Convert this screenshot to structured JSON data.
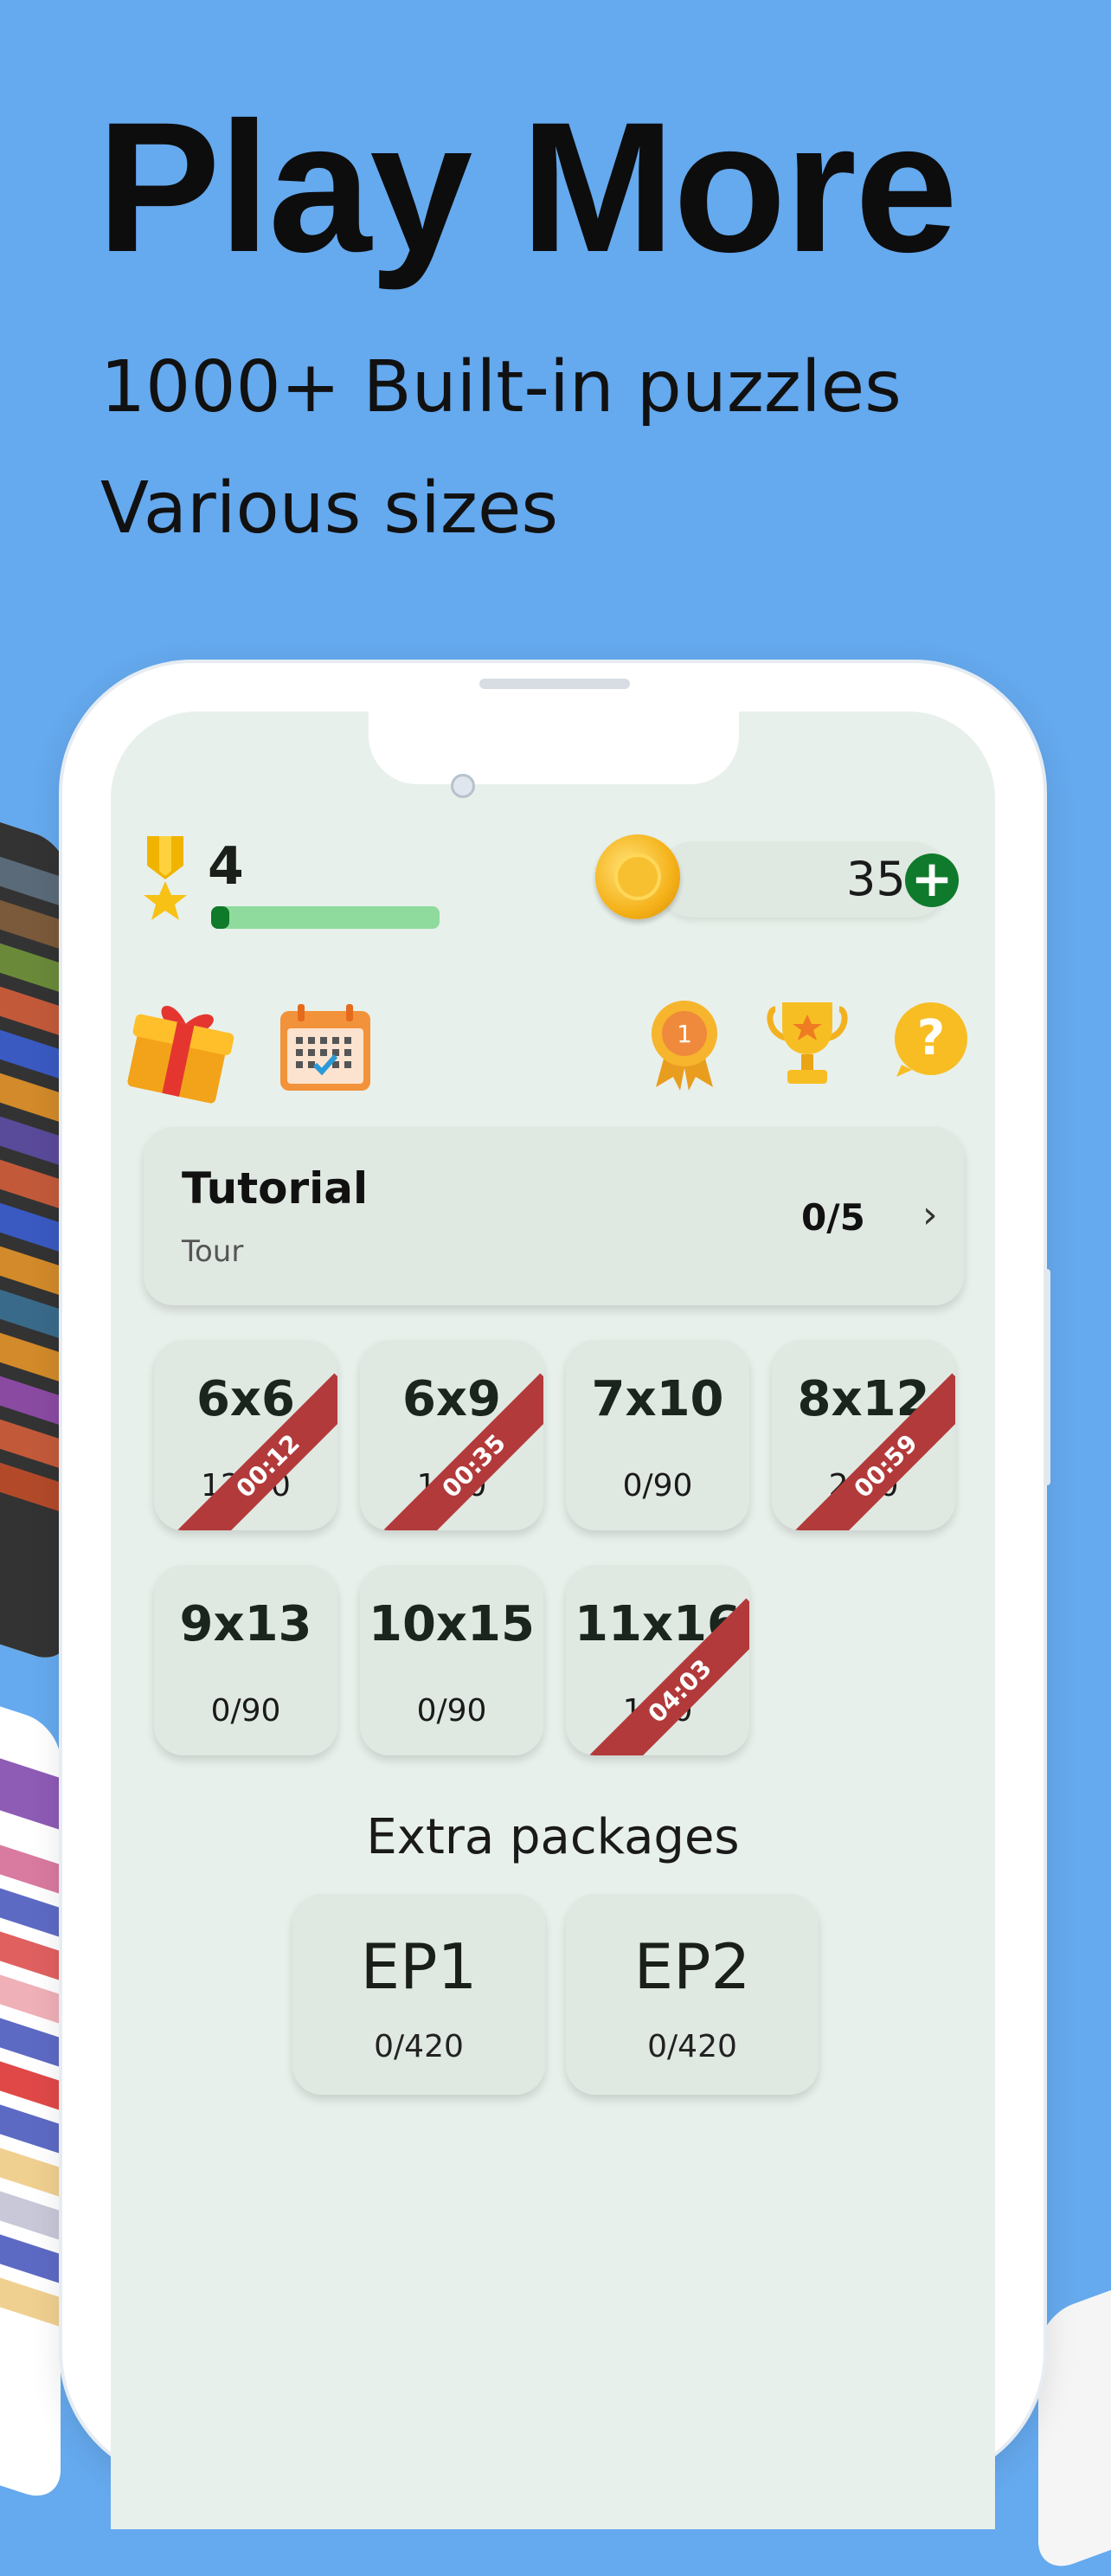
{
  "promo": {
    "headline": "Play More",
    "subline1": "1000+  Built-in puzzles",
    "subline2": "Various sizes"
  },
  "topbar": {
    "level": "4",
    "level_progress": 0.08,
    "coins": "35",
    "add_coins_label": "+"
  },
  "icons": [
    "gift-icon",
    "calendar-icon",
    "rank-medal-icon",
    "trophy-icon",
    "help-icon"
  ],
  "tutorial": {
    "title": "Tutorial",
    "subtitle": "Tour",
    "progress": "0/5",
    "chevron": "›"
  },
  "grids": [
    {
      "size": "6x6",
      "progress": "12/90",
      "timer": "00:12"
    },
    {
      "size": "6x9",
      "progress": "1/90",
      "timer": "00:35"
    },
    {
      "size": "7x10",
      "progress": "0/90",
      "timer": ""
    },
    {
      "size": "8x12",
      "progress": "2/90",
      "timer": "00:59"
    },
    {
      "size": "9x13",
      "progress": "0/90",
      "timer": ""
    },
    {
      "size": "10x15",
      "progress": "0/90",
      "timer": ""
    },
    {
      "size": "11x16",
      "progress": "1/90",
      "timer": "04:03"
    }
  ],
  "extra": {
    "title": "Extra packages",
    "packages": [
      {
        "name": "EP1",
        "progress": "0/420"
      },
      {
        "name": "EP2",
        "progress": "0/420"
      }
    ]
  },
  "colors": {
    "background": "#65a9ee",
    "screen": "#e8f0eb",
    "accent_green": "#107a2c",
    "ribbon_red": "#b23a3a"
  }
}
